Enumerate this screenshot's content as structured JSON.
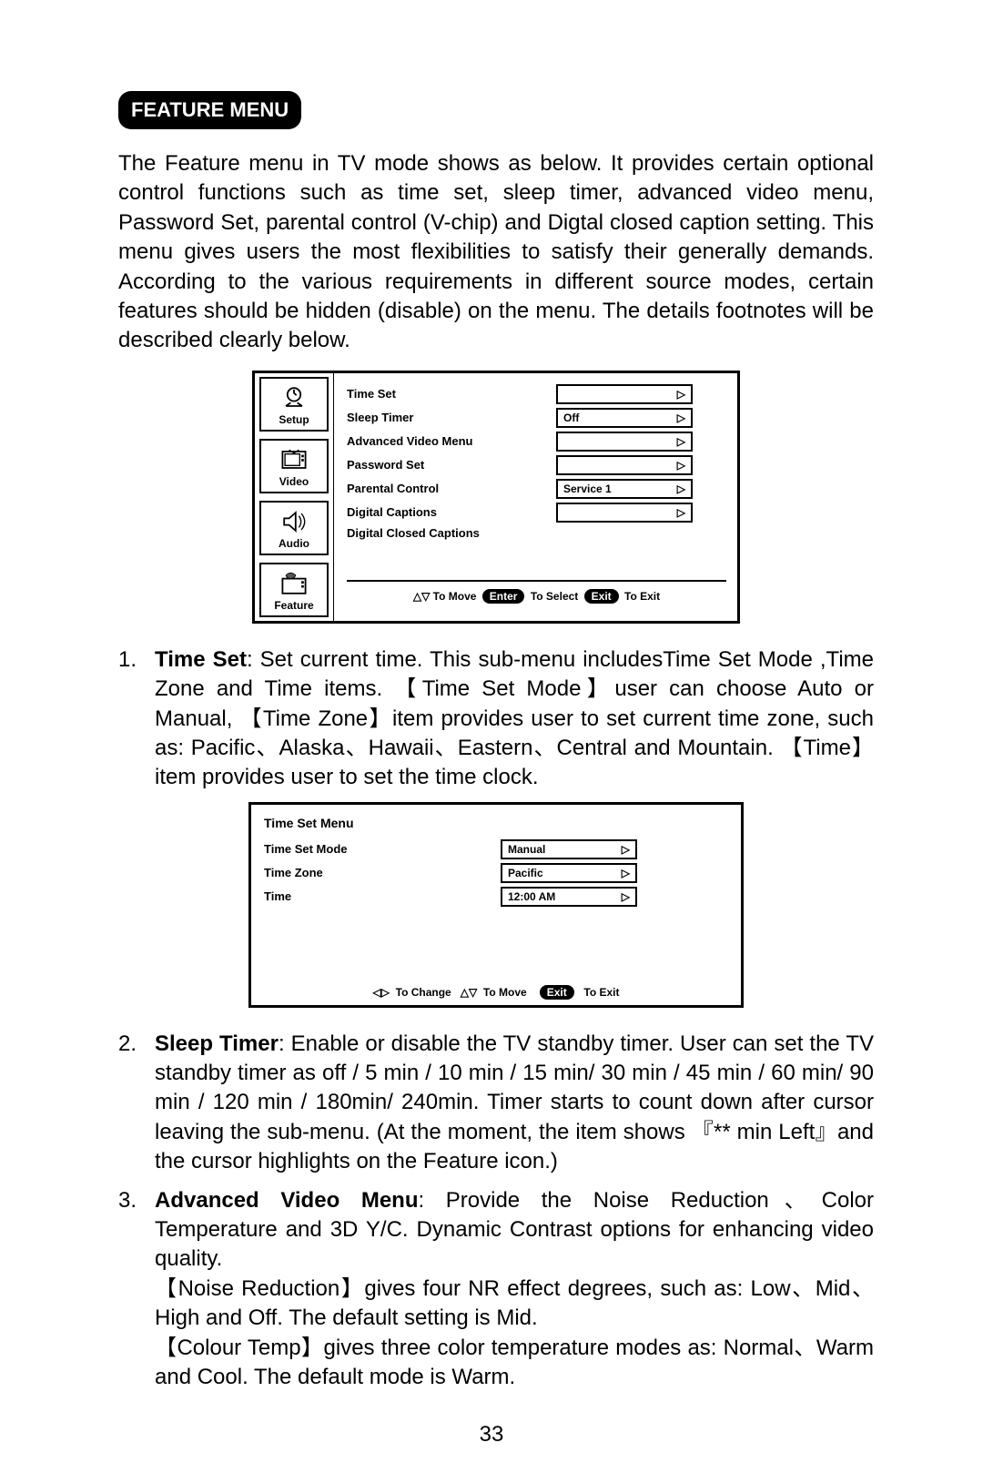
{
  "header": {
    "title": "FEATURE MENU"
  },
  "intro": "The Feature menu in TV mode shows as below. It provides certain optional control functions such as time set, sleep timer, advanced video menu, Password Set, parental control (V-chip) and Digtal closed caption setting. This menu gives users the most flexibilities to satisfy their generally demands. According to the various requirements in different source modes, certain features should be hidden (disable) on the menu. The details footnotes will be described clearly below.",
  "featureMenu": {
    "side": [
      {
        "label": "Setup"
      },
      {
        "label": "Video"
      },
      {
        "label": "Audio"
      },
      {
        "label": "Feature"
      }
    ],
    "rows": [
      {
        "label": "Time Set",
        "value": ""
      },
      {
        "label": "Sleep Timer",
        "value": "Off"
      },
      {
        "label": "Advanced Video Menu",
        "value": ""
      },
      {
        "label": "Password Set",
        "value": ""
      },
      {
        "label": "Parental Control",
        "value": "Service 1"
      },
      {
        "label": "Digital Captions",
        "value": ""
      },
      {
        "label": "Digital Closed Captions",
        "value": ""
      }
    ],
    "help": {
      "move": "To Move",
      "enter": "Enter",
      "select": "To Select",
      "exit": "Exit",
      "toExit": "To Exit"
    }
  },
  "timeSetMenu": {
    "title": "Time Set Menu",
    "rows": [
      {
        "label": "Time Set Mode",
        "value": "Manual"
      },
      {
        "label": "Time Zone",
        "value": "Pacific"
      },
      {
        "label": "Time",
        "value": "12:00 AM"
      }
    ],
    "help": {
      "change": "To Change",
      "move": "To Move",
      "exit": "Exit",
      "toExit": "To Exit"
    }
  },
  "items": [
    {
      "num": "1.",
      "lead": "Time Set",
      "body": ": Set current time. This sub-menu includesTime Set Mode ,Time Zone and Time items. 【Time Set Mode】user can  choose Auto or Manual, 【Time Zone】item provides user to set current time zone, such as: Pacific、Alaska、Hawaii、Eastern、Central and Mountain. 【Time】item provides user to set the time clock."
    },
    {
      "num": "2.",
      "lead": "Sleep Timer",
      "body": ": Enable or disable the TV standby timer. User can set the TV standby timer as off / 5 min / 10 min / 15 min/ 30 min / 45 min / 60 min/ 90 min / 120 min / 180min/ 240min. Timer starts to count down after cursor leaving the sub-menu. (At the moment, the item shows 『** min Left』and the cursor highlights on the Feature icon.)"
    },
    {
      "num": "3.",
      "lead": "Advanced Video Menu",
      "body": ": Provide the Noise Reduction、Color Temperature and 3D Y/C. Dynamic Contrast options for enhancing video quality.\n【Noise Reduction】gives four NR effect degrees, such as: Low、Mid、High and Off. The default setting is Mid.\n【Colour Temp】gives three color temperature modes as: Normal、Warm and Cool. The default mode is Warm."
    }
  ],
  "pageNumber": "33"
}
